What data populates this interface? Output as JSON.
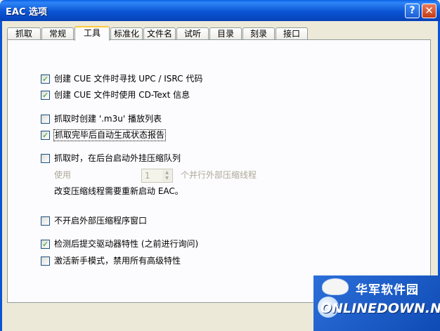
{
  "window": {
    "title": "EAC 选项",
    "help": "?",
    "close": "✕"
  },
  "tabs": [
    "抓取",
    "常规",
    "工具",
    "标准化",
    "文件名",
    "试听",
    "目录",
    "刻录",
    "接口"
  ],
  "active_tab": "工具",
  "options": {
    "cue_upc": {
      "label": "创建 CUE 文件时寻找 UPC / ISRC 代码",
      "checked": true
    },
    "cue_cdtext": {
      "label": "创建 CUE 文件时使用 CD-Text 信息",
      "checked": true
    },
    "m3u": {
      "label": "抓取时创建 '.m3u' 播放列表",
      "checked": false
    },
    "status_report": {
      "label": "抓取完毕后自动生成状态报告",
      "checked": true
    },
    "ext_queue": {
      "label": "抓取时，在后台启动外挂压缩队列",
      "checked": false
    },
    "no_ext_window": {
      "label": "不开启外部压缩程序窗口",
      "checked": false
    },
    "submit_drive": {
      "label": "检测后提交驱动器特性 (之前进行询问)",
      "checked": true
    },
    "beginner": {
      "label": "激活新手模式，禁用所有高级特性",
      "checked": false
    }
  },
  "threads": {
    "use_label": "使用",
    "value": "1",
    "suffix": "个并行外部压缩线程",
    "note": "改变压缩线程需要重新启动 EAC。"
  },
  "watermark": {
    "cn": "华军软件园",
    "en": "ONLINEDOWN.NET"
  },
  "colors": {
    "check": "#21A121",
    "titlebar": "#0B54D4",
    "focus_tab": "#FFC83C"
  }
}
